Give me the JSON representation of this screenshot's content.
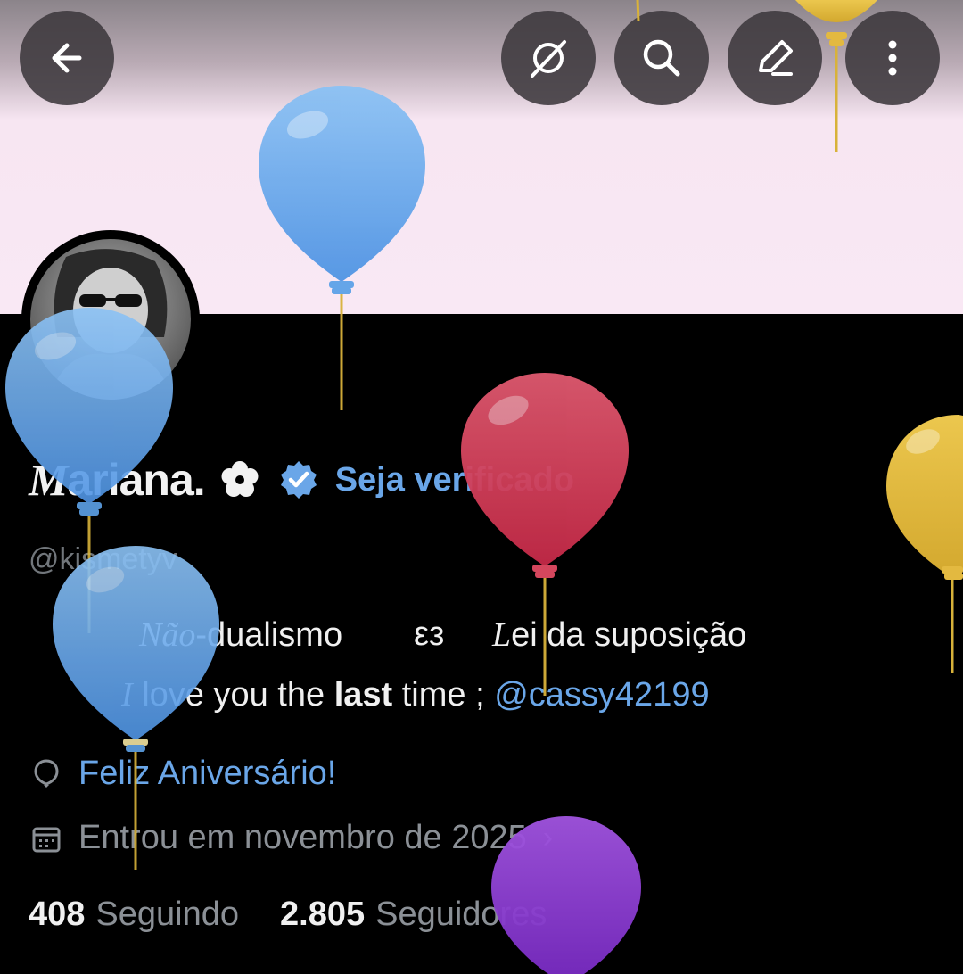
{
  "toolbar": {
    "back": "back-arrow-icon",
    "grok": "grok-icon",
    "search": "search-icon",
    "edit": "edit-icon",
    "more": "more-vertical-icon"
  },
  "profile": {
    "name_glyph": "M",
    "name_rest": "ariana.",
    "get_verified": "Seja verificado",
    "handle": "@kismetyv",
    "bio_line1": {
      "part1_script": "Não",
      "part2": "-dualismo",
      "part3": "εз",
      "part4_script": "L",
      "part5": "ei da suposição"
    },
    "bio_line2": {
      "part1_script": "I",
      "part2": "love you the ",
      "part3_bold": "last",
      "part4": " time ; ",
      "mention": "@cassy42199"
    },
    "birthday": "Feliz Aniversário!",
    "joined": "Entrou em novembro de 2025",
    "following_count": "408",
    "following_label": "Seguindo",
    "followers_count": "2.805",
    "followers_label": "Seguidores"
  },
  "colors": {
    "accent": "#6aa6e8",
    "balloon_blue": "#5ea2e8",
    "balloon_red": "#d23a55",
    "balloon_yellow": "#e0b83c",
    "balloon_purple": "#8a36d0"
  }
}
